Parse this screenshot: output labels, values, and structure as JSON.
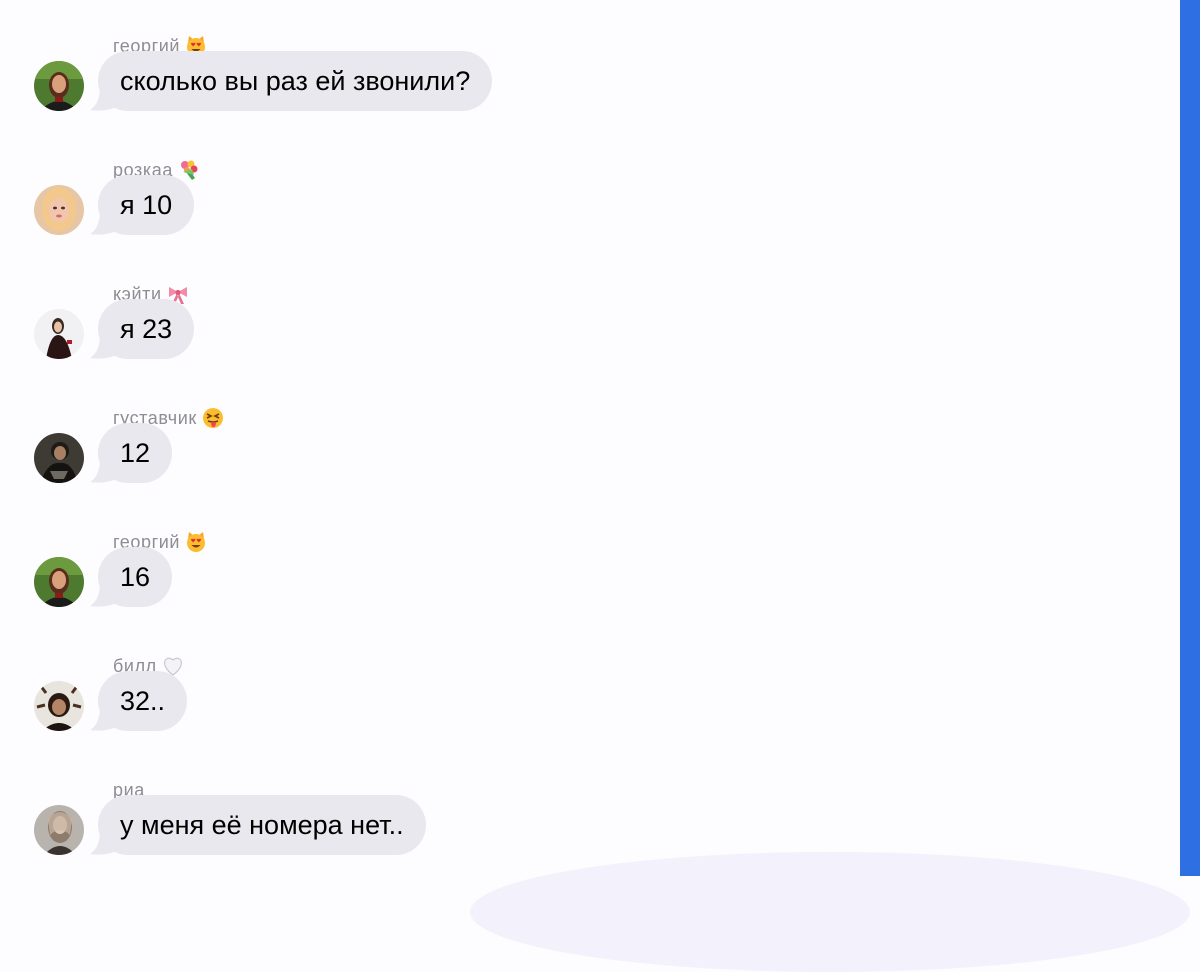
{
  "messages": [
    {
      "sender": "георгий",
      "sender_emoji": "heart-eyes-cat-emoji",
      "text": "сколько вы раз ей звонили?",
      "avatar": "avatar-georgiy"
    },
    {
      "sender": "розкаа",
      "sender_emoji": "bouquet-emoji",
      "text": "я 10",
      "avatar": "avatar-rozkaa"
    },
    {
      "sender": "кэйти",
      "sender_emoji": "ribbon-bow-emoji",
      "text": "я 23",
      "avatar": "avatar-keyti"
    },
    {
      "sender": "густавчик",
      "sender_emoji": "tongue-out-face-emoji",
      "text": "12",
      "avatar": "avatar-gustavchik"
    },
    {
      "sender": "георгий",
      "sender_emoji": "heart-eyes-cat-emoji",
      "text": "16",
      "avatar": "avatar-georgiy"
    },
    {
      "sender": "билл",
      "sender_emoji": "white-heart-emoji",
      "text": "32..",
      "avatar": "avatar-bill"
    },
    {
      "sender": "риа",
      "sender_emoji": "",
      "text": "у меня её номера нет..",
      "avatar": "avatar-ria"
    }
  ],
  "colors": {
    "background": "#fdfcff",
    "bubble": "#e9e8ee",
    "sender_text": "#8d8d93",
    "message_text": "#000000",
    "scrollbar": "#2f6fe4"
  }
}
